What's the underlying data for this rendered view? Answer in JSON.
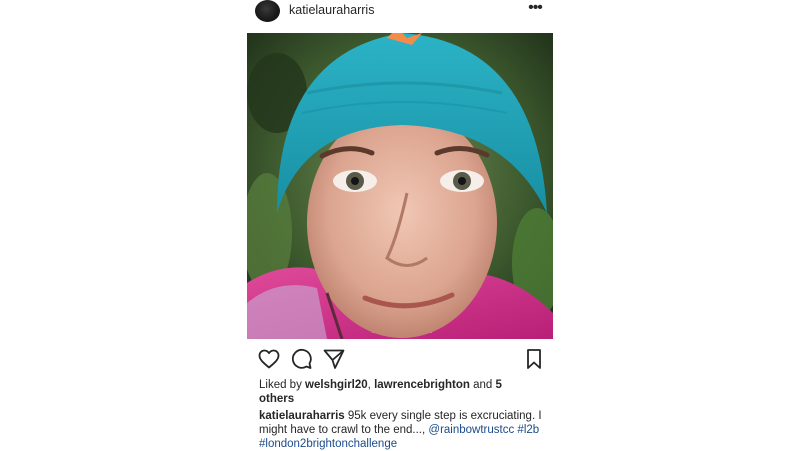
{
  "post": {
    "username": "katielauraharris",
    "more_icon": "more-horizontal-icon",
    "more_glyph": "•••",
    "photo_alt": "",
    "actions": {
      "like_icon": "heart-icon",
      "comment_icon": "comment-icon",
      "share_icon": "send-icon",
      "save_icon": "bookmark-icon"
    },
    "likes": {
      "prefix": "Liked by ",
      "user1": "welshgirl20",
      "separator": ", ",
      "user2": "lawrencebrighton",
      "conjunction": " and ",
      "others": "5 others"
    },
    "caption": {
      "username": "katielauraharris",
      "text": " 95k every single step is excruciating. I might have to crawl to the end..., ",
      "tags": [
        "@rainbowtrustcc",
        "#l2b",
        "#london2brightonchallenge"
      ]
    }
  },
  "colors": {
    "text": "#262626",
    "link": "#1b4b8a",
    "hat": "#1fa2b4",
    "jacket": "#d0308a"
  }
}
